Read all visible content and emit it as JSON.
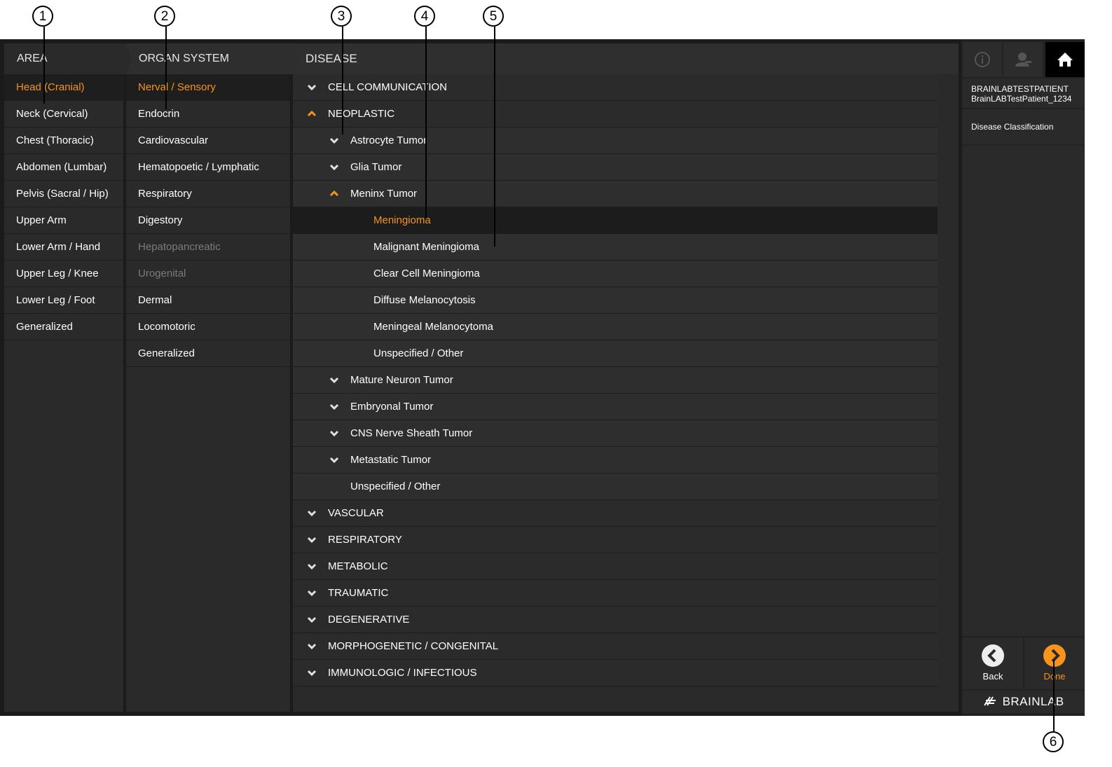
{
  "callouts": [
    "1",
    "2",
    "3",
    "4",
    "5",
    "6"
  ],
  "area": {
    "header": "AREA",
    "items": [
      {
        "label": "Head (Cranial)",
        "state": "selected"
      },
      {
        "label": "Neck (Cervical)",
        "state": "normal"
      },
      {
        "label": "Chest (Thoracic)",
        "state": "normal"
      },
      {
        "label": "Abdomen (Lumbar)",
        "state": "normal"
      },
      {
        "label": "Pelvis (Sacral / Hip)",
        "state": "normal"
      },
      {
        "label": "Upper Arm",
        "state": "normal"
      },
      {
        "label": "Lower Arm / Hand",
        "state": "normal"
      },
      {
        "label": "Upper Leg / Knee",
        "state": "normal"
      },
      {
        "label": "Lower Leg / Foot",
        "state": "normal"
      },
      {
        "label": "Generalized",
        "state": "normal"
      }
    ]
  },
  "organ": {
    "header": "ORGAN SYSTEM",
    "items": [
      {
        "label": "Nerval / Sensory",
        "state": "selected"
      },
      {
        "label": "Endocrin",
        "state": "normal"
      },
      {
        "label": "Cardiovascular",
        "state": "normal"
      },
      {
        "label": "Hematopoetic / Lymphatic",
        "state": "normal"
      },
      {
        "label": "Respiratory",
        "state": "normal"
      },
      {
        "label": "Digestory",
        "state": "normal"
      },
      {
        "label": "Hepatopancreatic",
        "state": "disabled"
      },
      {
        "label": "Urogenital",
        "state": "disabled"
      },
      {
        "label": "Dermal",
        "state": "normal"
      },
      {
        "label": "Locomotoric",
        "state": "normal"
      },
      {
        "label": "Generalized",
        "state": "normal"
      }
    ]
  },
  "disease": {
    "header": "DISEASE",
    "items": [
      {
        "label": "CELL COMMUNICATION",
        "level": 1,
        "toggle": "collapsed"
      },
      {
        "label": "NEOPLASTIC",
        "level": 1,
        "toggle": "expanded"
      },
      {
        "label": "Astrocyte Tumor",
        "level": 2,
        "toggle": "collapsed"
      },
      {
        "label": "Glia Tumor",
        "level": 2,
        "toggle": "collapsed"
      },
      {
        "label": "Meninx Tumor",
        "level": 2,
        "toggle": "expanded"
      },
      {
        "label": "Meningioma",
        "level": 3,
        "toggle": "none",
        "state": "selected"
      },
      {
        "label": "Malignant Meningioma",
        "level": 3,
        "toggle": "none"
      },
      {
        "label": "Clear Cell Meningioma",
        "level": 3,
        "toggle": "none"
      },
      {
        "label": "Diffuse Melanocytosis",
        "level": 3,
        "toggle": "none"
      },
      {
        "label": "Meningeal Melanocytoma",
        "level": 3,
        "toggle": "none"
      },
      {
        "label": "Unspecified / Other",
        "level": 3,
        "toggle": "none"
      },
      {
        "label": "Mature Neuron Tumor",
        "level": 2,
        "toggle": "collapsed"
      },
      {
        "label": "Embryonal Tumor",
        "level": 2,
        "toggle": "collapsed"
      },
      {
        "label": "CNS Nerve Sheath Tumor",
        "level": 2,
        "toggle": "collapsed"
      },
      {
        "label": "Metastatic Tumor",
        "level": 2,
        "toggle": "collapsed"
      },
      {
        "label": "Unspecified / Other",
        "level": 2,
        "toggle": "none"
      },
      {
        "label": "VASCULAR",
        "level": 1,
        "toggle": "collapsed"
      },
      {
        "label": "RESPIRATORY",
        "level": 1,
        "toggle": "collapsed"
      },
      {
        "label": "METABOLIC",
        "level": 1,
        "toggle": "collapsed"
      },
      {
        "label": "TRAUMATIC",
        "level": 1,
        "toggle": "collapsed"
      },
      {
        "label": "DEGENERATIVE",
        "level": 1,
        "toggle": "collapsed"
      },
      {
        "label": "MORPHOGENETIC / CONGENITAL",
        "level": 1,
        "toggle": "collapsed"
      },
      {
        "label": "IMMUNOLOGIC / INFECTIOUS",
        "level": 1,
        "toggle": "collapsed"
      }
    ]
  },
  "right_panel": {
    "toolbar_icons": [
      "info-icon",
      "user-icon",
      "home-icon"
    ],
    "patient_name": "BRAINLABTESTPATIENT",
    "patient_id": "BrainLABTestPatient_1234",
    "task": "Disease Classification",
    "back_label": "Back",
    "done_label": "Done",
    "logo": "BRAINLAB"
  },
  "colors": {
    "accent": "#f7941d",
    "background": "#1b1b1b",
    "panel": "#2a2a2a",
    "text": "#ffffff",
    "disabled": "#7b7b7b"
  }
}
